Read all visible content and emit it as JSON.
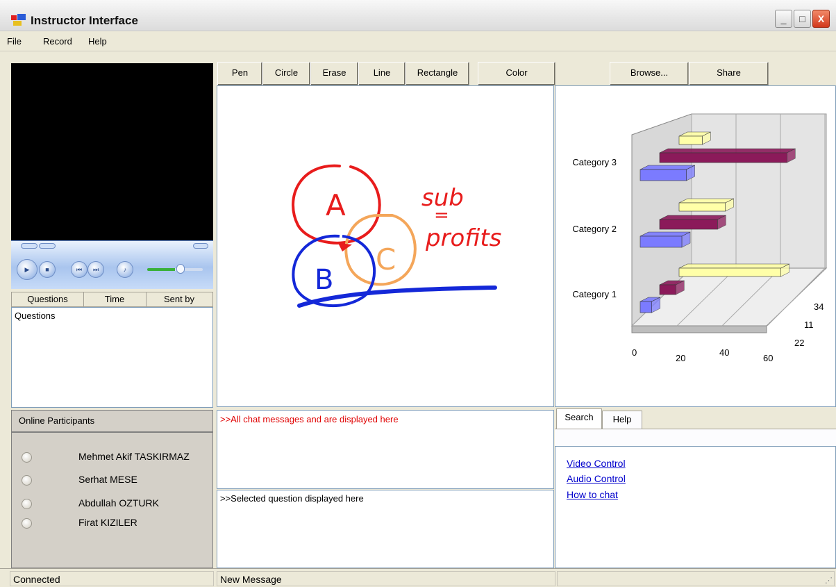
{
  "window": {
    "title": "Instructor Interface",
    "minimize": "_",
    "maximize": "□",
    "close": "X"
  },
  "menu": [
    "File",
    "Record",
    "Help"
  ],
  "whiteboard": {
    "tools": [
      "Pen",
      "Circle",
      "Erase",
      "Line",
      "Rectangle"
    ],
    "color_button": "Color",
    "drawing_text": {
      "a": "A",
      "b": "B",
      "c": "C",
      "sub": "sub",
      "eq": "=",
      "profits": "profits"
    }
  },
  "share_bar": {
    "browse": "Browse...",
    "share": "Share"
  },
  "questions": {
    "columns": [
      "Questions",
      "Time",
      "Sent by"
    ],
    "list_text": "Questions"
  },
  "participants": {
    "header": "Online Participants",
    "names": [
      "Mehmet Akif TASKIRMAZ",
      "Serhat MESE",
      "Abdullah OZTURK",
      "Firat KIZILER"
    ]
  },
  "chat": {
    "all_messages": ">>All chat messages  and are displayed here",
    "selected_question": ">>Selected question displayed here"
  },
  "chart_data": {
    "type": "bar",
    "orientation": "horizontal-3d",
    "categories": [
      "Category 1",
      "Category 2",
      "Category 3"
    ],
    "series": [
      {
        "values": [
          5,
          18,
          20
        ],
        "color": "#7b7bff"
      },
      {
        "values": [
          7,
          25,
          55
        ],
        "color": "#8b1a5a"
      },
      {
        "values": [
          44,
          20,
          10
        ],
        "color": "#ffffa8"
      }
    ],
    "x_ticks": [
      "0",
      "20",
      "40",
      "60"
    ],
    "depth_ticks": [
      "34",
      "11",
      "22"
    ],
    "xlim": [
      0,
      60
    ]
  },
  "tabs": [
    "Search",
    "Help"
  ],
  "help_links": [
    "Video Control",
    "Audio Control",
    "How to chat"
  ],
  "status": {
    "left": "Connected",
    "middle": "New Message"
  },
  "colors": {
    "pen_red": "#e81c1c",
    "pen_blue": "#1428d8",
    "pen_orange": "#f4a65a",
    "chat_red": "#e00000"
  }
}
